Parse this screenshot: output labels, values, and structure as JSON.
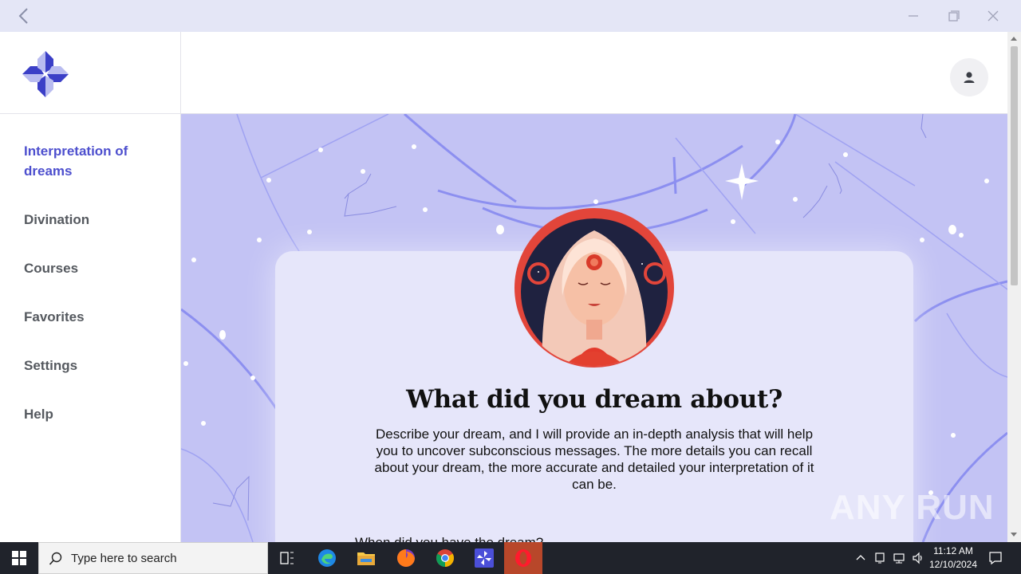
{
  "window": {
    "back_icon": "back-arrow-icon",
    "controls": [
      "minimize-icon",
      "restore-icon",
      "close-icon"
    ]
  },
  "sidebar": {
    "logo_icon": "pinwheel-logo-icon",
    "items": [
      {
        "label": "Interpretation of dreams",
        "active": true
      },
      {
        "label": "Divination",
        "active": false
      },
      {
        "label": "Courses",
        "active": false
      },
      {
        "label": "Favorites",
        "active": false
      },
      {
        "label": "Settings",
        "active": false
      },
      {
        "label": "Help",
        "active": false
      }
    ]
  },
  "header": {
    "avatar_icon": "user-icon"
  },
  "main": {
    "title": "What did you dream about?",
    "description": "Describe your dream, and I will provide an in-depth analysis that will help you to uncover subconscious messages. The more details you can recall about your dream, the more accurate and detailed your interpretation of it can be.",
    "partial_question": "When did you have the dream?"
  },
  "watermark": "ANY RUN",
  "taskbar": {
    "search_placeholder": "Type here to search",
    "time": "11:12 AM",
    "date": "12/10/2024"
  },
  "colors": {
    "accent": "#4d4fce",
    "main_bg": "#c3c3f4",
    "card_bg": "#e6e6fa",
    "taskbar_bg": "#20232b"
  }
}
